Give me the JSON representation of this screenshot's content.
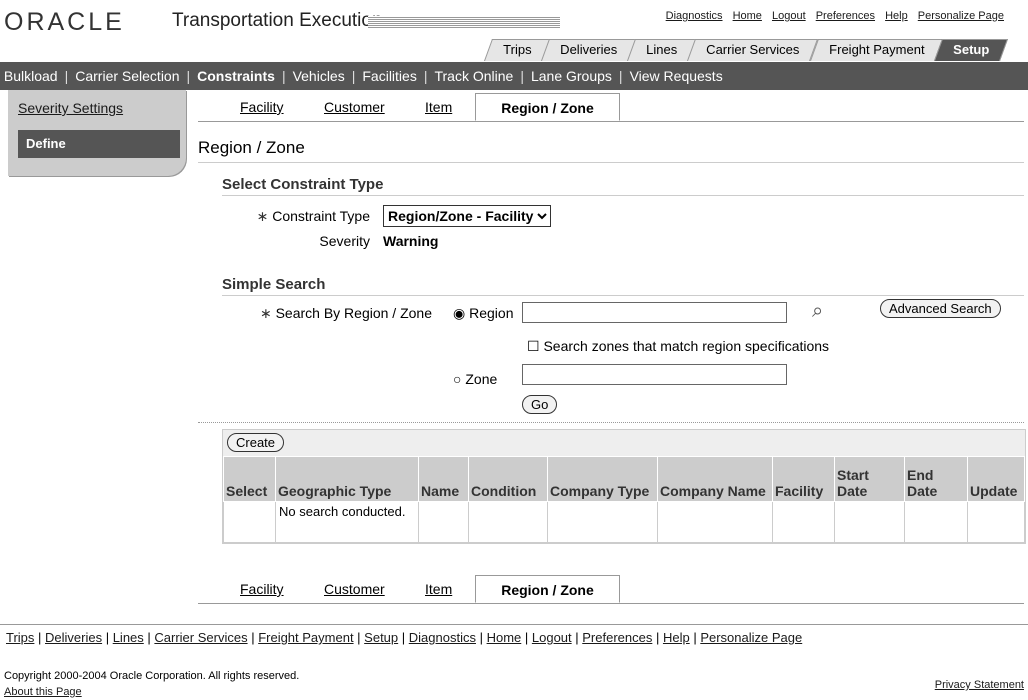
{
  "header": {
    "logo": "ORACLE",
    "app_title": "Transportation Execution",
    "global_links": [
      "Diagnostics",
      "Home",
      "Logout",
      "Preferences",
      "Help",
      "Personalize Page"
    ]
  },
  "tabs": [
    "Trips",
    "Deliveries",
    "Lines",
    "Carrier Services",
    "Freight Payment",
    "Setup"
  ],
  "subnav": {
    "items": [
      "Bulkload",
      "Carrier Selection",
      "Constraints",
      "Vehicles",
      "Facilities",
      "Track Online",
      "Lane Groups",
      "View Requests"
    ],
    "current": "Constraints"
  },
  "side": {
    "severity": "Severity Settings",
    "define": "Define"
  },
  "subtabs": {
    "facility": "Facility",
    "customer": "Customer",
    "item": "Item",
    "selected": "Region / Zone"
  },
  "page_title": "Region / Zone",
  "constraint": {
    "section": "Select Constraint Type",
    "type_label": "Constraint Type",
    "type_value": "Region/Zone - Facility",
    "severity_label": "Severity",
    "severity_value": "Warning"
  },
  "search": {
    "section": "Simple Search",
    "by_label": "Search By Region / Zone",
    "region_label": "Region",
    "region_value": "",
    "zone_label": "Zone",
    "zone_value": "",
    "match_label": "Search zones that match region specifications",
    "advanced": "Advanced Search",
    "go": "Go"
  },
  "results": {
    "create": "Create",
    "columns": [
      "Select",
      "Geographic Type",
      "Name",
      "Condition",
      "Company Type",
      "Company Name",
      "Facility",
      "Start Date",
      "End Date",
      "Update"
    ],
    "empty": "No search conducted."
  },
  "footer": {
    "links": [
      "Trips",
      "Deliveries",
      "Lines",
      "Carrier Services",
      "Freight Payment",
      "Setup",
      "Diagnostics",
      "Home",
      "Logout",
      "Preferences",
      "Help",
      "Personalize Page"
    ],
    "copyright": "Copyright 2000-2004 Oracle Corporation. All rights reserved.",
    "about": "About this Page",
    "privacy": "Privacy Statement"
  }
}
